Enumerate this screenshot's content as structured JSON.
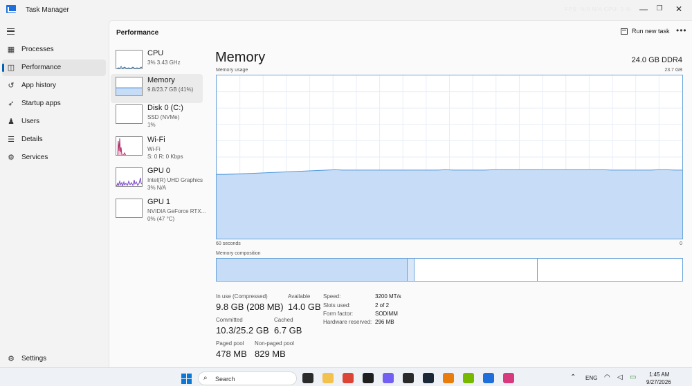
{
  "window": {
    "title": "Task Manager",
    "titlebar_stats": "FPS: N/A  N/A  CPU: 0 %",
    "minimize": "—",
    "maximize": "❐",
    "close": "✕"
  },
  "nav": {
    "items": [
      {
        "label": "Processes",
        "icon": "processes-icon",
        "glyph": "▦",
        "active": false
      },
      {
        "label": "Performance",
        "icon": "performance-icon",
        "glyph": "◫",
        "active": true
      },
      {
        "label": "App history",
        "icon": "app-history-icon",
        "glyph": "↺",
        "active": false
      },
      {
        "label": "Startup apps",
        "icon": "startup-icon",
        "glyph": "➶",
        "active": false
      },
      {
        "label": "Users",
        "icon": "users-icon",
        "glyph": "♟",
        "active": false
      },
      {
        "label": "Details",
        "icon": "details-icon",
        "glyph": "☰",
        "active": false
      },
      {
        "label": "Services",
        "icon": "services-icon",
        "glyph": "⚙",
        "active": false
      }
    ],
    "settings": {
      "label": "Settings",
      "icon": "settings-icon",
      "glyph": "⚙"
    }
  },
  "header": {
    "title": "Performance",
    "run_new_task": "Run new task",
    "more": "•••"
  },
  "resources": [
    {
      "name": "CPU",
      "lines": [
        "3% 3.43 GHz"
      ]
    },
    {
      "name": "Memory",
      "lines": [
        "9.8/23.7 GB (41%)"
      ]
    },
    {
      "name": "Disk 0 (C:)",
      "lines": [
        "SSD (NVMe)",
        "1%"
      ]
    },
    {
      "name": "Wi-Fi",
      "lines": [
        "Wi-Fi",
        "S: 0 R: 0 Kbps"
      ]
    },
    {
      "name": "GPU 0",
      "lines": [
        "Intel(R) UHD Graphics",
        "3% N/A"
      ]
    },
    {
      "name": "GPU 1",
      "lines": [
        "NVIDIA GeForce RTX...",
        "0% (47 °C)"
      ]
    }
  ],
  "detail": {
    "title": "Memory",
    "spec": "24.0 GB DDR4",
    "usage_label": "Memory usage",
    "max_label": "23.7 GB",
    "time_label": "60 seconds",
    "zero_label": "0",
    "composition_label": "Memory composition",
    "composition": {
      "in_use_fraction": 0.41,
      "modified_fraction": 0.015,
      "standby_fraction": 0.265
    }
  },
  "chart_data": {
    "type": "area",
    "title": "Memory usage",
    "ylim": [
      0,
      23.7
    ],
    "y_unit": "GB",
    "x_range_label": "60 seconds",
    "grid": true,
    "series": [
      {
        "values": [
          9.3,
          9.3,
          9.35,
          9.4,
          9.45,
          9.5,
          9.55,
          9.6,
          9.65,
          9.7,
          9.75,
          9.8,
          9.85,
          9.9,
          9.95,
          10.0,
          9.95,
          9.95,
          9.95,
          9.95,
          9.95,
          9.95,
          9.95,
          9.95,
          9.95,
          9.95,
          9.95,
          9.95,
          9.95,
          10.0,
          9.95,
          9.95,
          9.95,
          9.95,
          9.95,
          10.0,
          10.0,
          10.0,
          10.0,
          10.0,
          10.0,
          10.0,
          10.0,
          10.0,
          10.0,
          10.0,
          10.0,
          10.0,
          10.0,
          10.0,
          9.95,
          9.95,
          9.95,
          9.95,
          9.95,
          9.95,
          10.0,
          10.0,
          9.95,
          9.95
        ]
      }
    ]
  },
  "stats": {
    "in_use_label": "In use (Compressed)",
    "in_use_value": "9.8 GB (208 MB)",
    "available_label": "Available",
    "available_value": "14.0 GB",
    "committed_label": "Committed",
    "committed_value": "10.3/25.2 GB",
    "cached_label": "Cached",
    "cached_value": "6.7 GB",
    "paged_label": "Paged pool",
    "paged_value": "478 MB",
    "nonpaged_label": "Non-paged pool",
    "nonpaged_value": "829 MB"
  },
  "specs": [
    {
      "label": "Speed:",
      "value": "3200 MT/s"
    },
    {
      "label": "Slots used:",
      "value": "2 of 2"
    },
    {
      "label": "Form factor:",
      "value": "SODIMM"
    },
    {
      "label": "Hardware reserved:",
      "value": "296 MB"
    }
  ],
  "taskbar": {
    "search_placeholder": "Search",
    "tray_lang": "ENG",
    "time": "1:45 AM",
    "date": "9/27/2026",
    "apps": [
      {
        "name": "task-view-icon",
        "color": "#2b2b2b"
      },
      {
        "name": "file-explorer-icon",
        "color": "#f2c14e"
      },
      {
        "name": "chrome-icon",
        "color": "#db4437"
      },
      {
        "name": "spotify-app-icon",
        "color": "#1f1f1f"
      },
      {
        "name": "viber-icon",
        "color": "#7360f2"
      },
      {
        "name": "epic-games-icon",
        "color": "#2a2a2a"
      },
      {
        "name": "steam-icon",
        "color": "#1b2838"
      },
      {
        "name": "blender-icon",
        "color": "#e87d0d"
      },
      {
        "name": "nvidia-icon",
        "color": "#76b900"
      },
      {
        "name": "task-manager-app-icon",
        "color": "#1e6fd9"
      },
      {
        "name": "snipping-tool-icon",
        "color": "#d83b7d"
      }
    ]
  },
  "colors": {
    "accent": "#005fb8",
    "graph_fill": "#c7ddf7",
    "graph_stroke": "#4f97dd"
  }
}
